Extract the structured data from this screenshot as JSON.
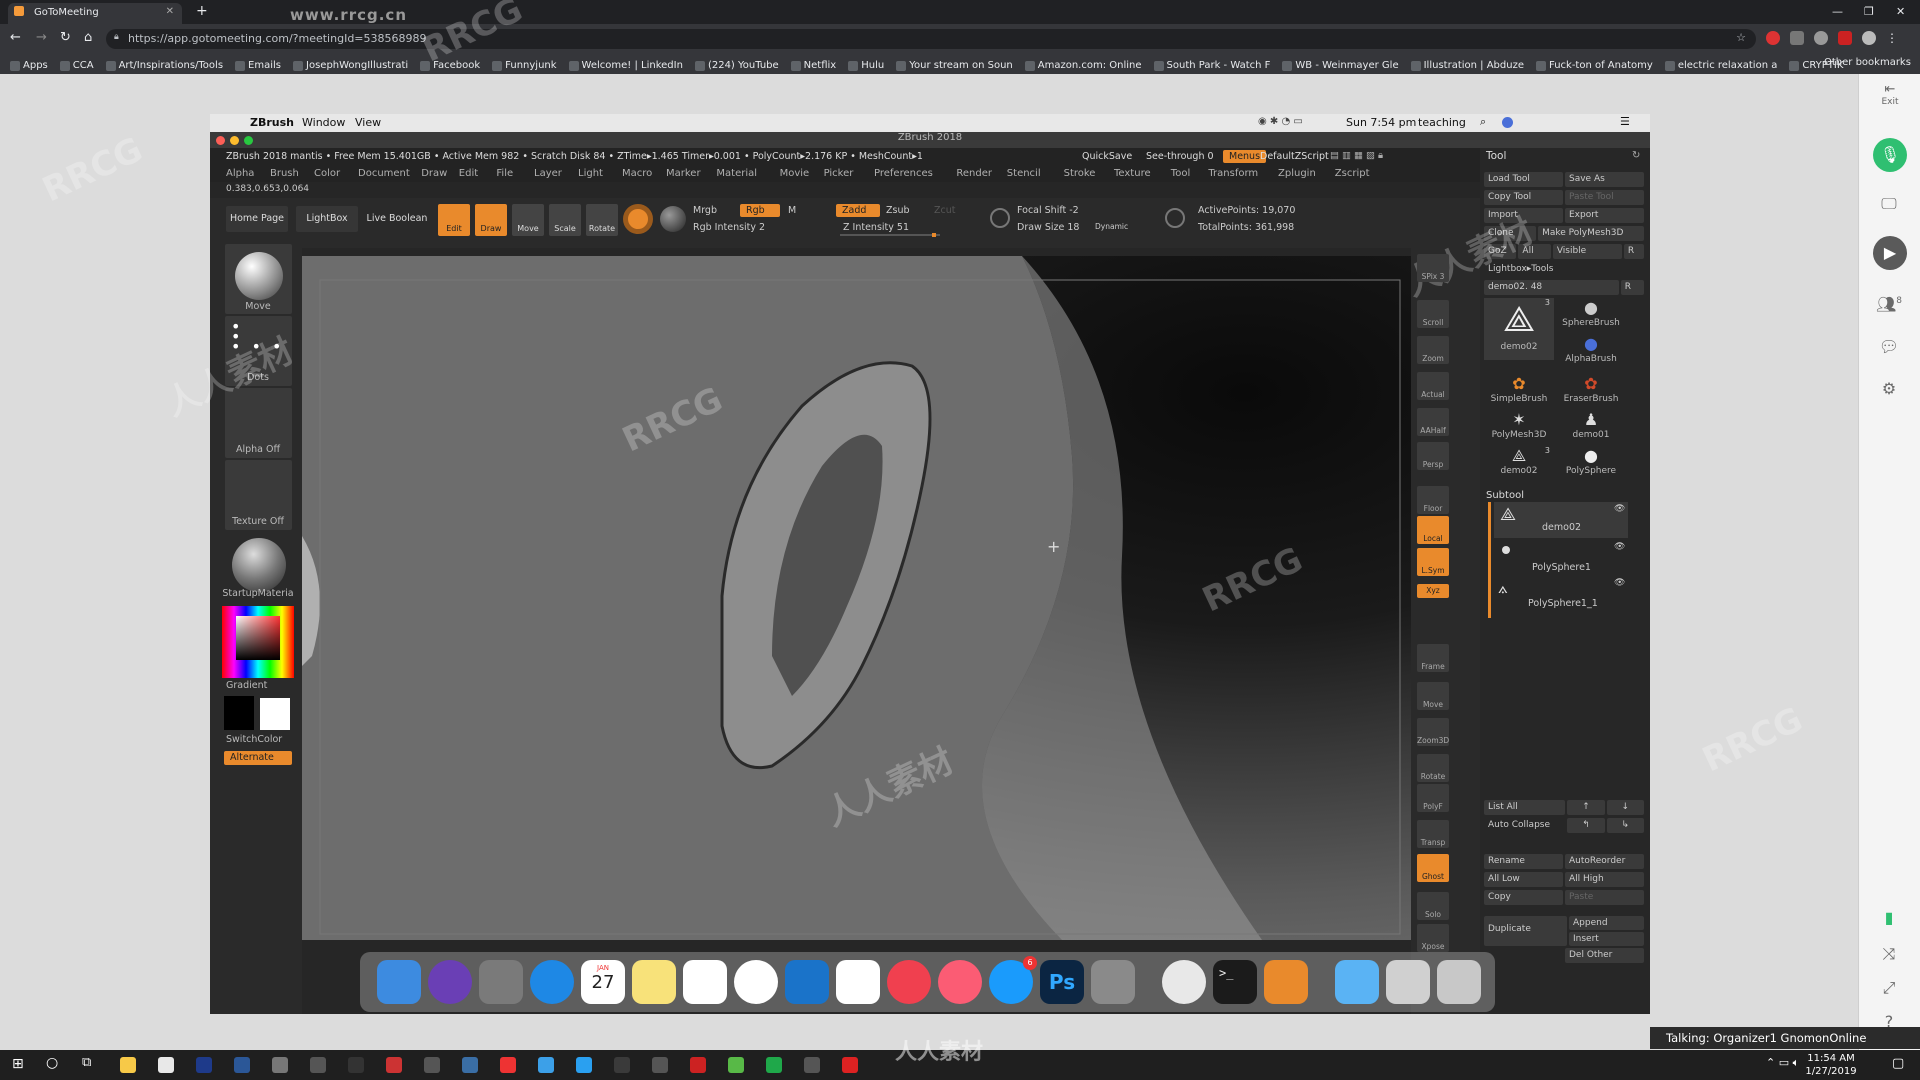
{
  "browser": {
    "tab_title": "GoToMeeting",
    "url": "https://app.gotomeeting.com/?meetingId=538568989",
    "watermark_top": "www.rrcg.cn",
    "bookmarks": [
      "Apps",
      "CCA",
      "Art/Inspirations/Tools",
      "Emails",
      "JosephWongIllustrati",
      "Facebook",
      "Funnyjunk",
      "Welcome! | LinkedIn",
      "(224) YouTube",
      "Netflix",
      "Hulu",
      "Your stream on Soun",
      "Amazon.com: Online",
      "South Park - Watch F",
      "WB - Weinmayer Gle",
      "Illustration | Abduze",
      "Fuck-ton of Anatomy",
      "electric relaxation a",
      "CRYPTIK"
    ],
    "other_bookmarks": "Other bookmarks"
  },
  "gotomeeting": {
    "exit_label": "Exit",
    "attendee_count": "8",
    "talking_text": "Talking: Organizer1 GnomonOnline"
  },
  "mac": {
    "menu": [
      "ZBrush",
      "Window",
      "View"
    ],
    "datetime": "Sun 7:54 pm",
    "user": "teaching",
    "window_title": "ZBrush 2018"
  },
  "zbrush": {
    "info_bar": "ZBrush 2018 mantis  • Free Mem 15.401GB • Active Mem 982 • Scratch Disk 84 • ZTime▸1.465 Timer▸0.001 • PolyCount▸2.176 KP • MeshCount▸1",
    "quicksave": "QuickSave",
    "see_through": "See-through  0",
    "menus_btn": "Menus",
    "default_zscript": "DefaultZScript",
    "menu_items": [
      "Alpha",
      "Brush",
      "Color",
      "Document",
      "Draw",
      "Edit",
      "File",
      "Layer",
      "Light",
      "Macro",
      "Marker",
      "Material",
      "Movie",
      "Picker",
      "Preferences",
      "Render",
      "Stencil",
      "Stroke",
      "Texture",
      "Tool",
      "Transform",
      "Zplugin",
      "Zscript"
    ],
    "coords": "0.383,0.653,0.064",
    "shelf": {
      "home_page": "Home Page",
      "lightbox": "LightBox",
      "live_boolean": "Live Boolean",
      "edit": "Edit",
      "draw": "Draw",
      "move": "Move",
      "scale": "Scale",
      "rotate": "Rotate",
      "mrgb": "Mrgb",
      "rgb": "Rgb",
      "m": "M",
      "rgb_intensity": "Rgb Intensity 2",
      "zadd": "Zadd",
      "zsub": "Zsub",
      "zcut": "Zcut",
      "z_intensity": "Z Intensity 51",
      "focal_shift": "Focal Shift -2",
      "draw_size": "Draw Size 18",
      "dynamic": "Dynamic",
      "active_points": "ActivePoints: 19,070",
      "total_points": "TotalPoints: 361,998"
    },
    "left_shelf": {
      "brush": "Move",
      "stroke": "Dots",
      "alpha": "Alpha Off",
      "texture": "Texture Off",
      "material": "StartupMateria",
      "gradient": "Gradient",
      "switch_color": "SwitchColor",
      "alternate": "Alternate"
    },
    "right_shelf": [
      "SPix 3",
      "Scroll",
      "Zoom",
      "Actual",
      "AAHalf",
      "Persp",
      "Floor",
      "Local",
      "L.Sym",
      "Xyz",
      "Frame",
      "Move",
      "Zoom3D",
      "Rotate",
      "PolyF",
      "Transp",
      "Ghost",
      "Solo",
      "Xpose"
    ],
    "tool_panel": {
      "title": "Tool",
      "load_tool": "Load Tool",
      "save_as": "Save As",
      "copy_tool": "Copy Tool",
      "paste_tool": "Paste Tool",
      "import": "Import",
      "export": "Export",
      "clone": "Clone",
      "make_polymesh": "Make PolyMesh3D",
      "goz": "GoZ",
      "all": "All",
      "visible": "Visible",
      "r": "R",
      "lightbox_tools": "Lightbox▸Tools",
      "current_tool": "demo02. 48",
      "tools": [
        {
          "name": "demo02",
          "badge": "3"
        },
        {
          "name": "SphereBrush"
        },
        {
          "name": "AlphaBrush"
        },
        {
          "name": "SimpleBrush"
        },
        {
          "name": "EraserBrush"
        },
        {
          "name": "PolyMesh3D"
        },
        {
          "name": "demo01"
        },
        {
          "name": "demo02",
          "badge": "3"
        },
        {
          "name": "PolySphere"
        }
      ],
      "subtool_title": "Subtool",
      "subtools": [
        "demo02",
        "PolySphere1",
        "PolySphere1_1"
      ],
      "list_all": "List All",
      "auto_collapse": "Auto Collapse",
      "rename": "Rename",
      "auto_reorder": "AutoReorder",
      "all_low": "All Low",
      "all_high": "All High",
      "copy": "Copy",
      "paste": "Paste",
      "duplicate": "Duplicate",
      "append": "Append",
      "insert": "Insert",
      "del_other": "Del Other"
    }
  },
  "dock": {
    "calendar_month": "JAN",
    "calendar_day": "27",
    "appstore_badge": "6",
    "ps_label": "Ps",
    "terminal_label": ">_"
  },
  "taskbar": {
    "time": "11:54 AM",
    "date": "1/27/2019"
  },
  "watermark": {
    "rrcg": "RRCG",
    "cn": "人人素材"
  }
}
